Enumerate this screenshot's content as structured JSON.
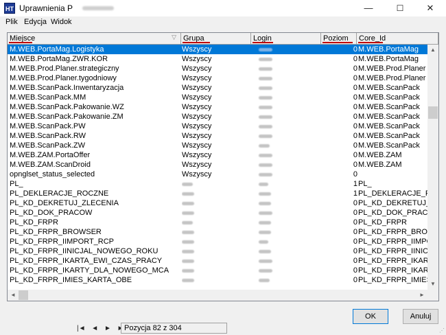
{
  "window": {
    "icon_text": "HT",
    "title": "Uprawnienia P",
    "min_glyph": "—",
    "max_glyph": "☐",
    "close_glyph": "✕"
  },
  "menu": {
    "items": [
      "Plik",
      "Edycja",
      "Widok"
    ]
  },
  "grid": {
    "columns": [
      "Miejsce",
      "Grupa",
      "Login",
      "Poziom",
      "Core_Id"
    ],
    "sort_glyph": "▽",
    "selected_index": 0,
    "rows": [
      {
        "miejsce": "M.WEB.PortaMag.Logistyka",
        "grupa": "Wszyscy",
        "poziom": "0",
        "core_id": "M.WEB.PortaMag"
      },
      {
        "miejsce": "M.WEB.PortaMag.ZWR.KOR",
        "grupa": "Wszyscy",
        "poziom": "0",
        "core_id": "M.WEB.PortaMag"
      },
      {
        "miejsce": "M.WEB.Prod.Planer.strategiczny",
        "grupa": "Wszyscy",
        "poziom": "0",
        "core_id": "M.WEB.Prod.Planer"
      },
      {
        "miejsce": "M.WEB.Prod.Planer.tygodniowy",
        "grupa": "Wszyscy",
        "poziom": "0",
        "core_id": "M.WEB.Prod.Planer"
      },
      {
        "miejsce": "M.WEB.ScanPack.Inwentaryzacja",
        "grupa": "Wszyscy",
        "poziom": "0",
        "core_id": "M.WEB.ScanPack"
      },
      {
        "miejsce": "M.WEB.ScanPack.MM",
        "grupa": "Wszyscy",
        "poziom": "0",
        "core_id": "M.WEB.ScanPack"
      },
      {
        "miejsce": "M.WEB.ScanPack.Pakowanie.WZ",
        "grupa": "Wszyscy",
        "poziom": "0",
        "core_id": "M.WEB.ScanPack"
      },
      {
        "miejsce": "M.WEB.ScanPack.Pakowanie.ZM",
        "grupa": "Wszyscy",
        "poziom": "0",
        "core_id": "M.WEB.ScanPack"
      },
      {
        "miejsce": "M.WEB.ScanPack.PW",
        "grupa": "Wszyscy",
        "poziom": "0",
        "core_id": "M.WEB.ScanPack"
      },
      {
        "miejsce": "M.WEB.ScanPack.RW",
        "grupa": "Wszyscy",
        "poziom": "0",
        "core_id": "M.WEB.ScanPack"
      },
      {
        "miejsce": "M.WEB.ScanPack.ZW",
        "grupa": "Wszyscy",
        "poziom": "0",
        "core_id": "M.WEB.ScanPack"
      },
      {
        "miejsce": "M.WEB.ZAM.PortaOffer",
        "grupa": "Wszyscy",
        "poziom": "0",
        "core_id": "M.WEB.ZAM"
      },
      {
        "miejsce": "M.WEB.ZAM.ScanDroid",
        "grupa": "Wszyscy",
        "poziom": "0",
        "core_id": "M.WEB.ZAM"
      },
      {
        "miejsce": "opnglset_status_selected",
        "grupa": "Wszyscy",
        "poziom": "0",
        "core_id": ""
      },
      {
        "miejsce": "PL_",
        "grupa": "",
        "poziom": "1",
        "core_id": "PL_"
      },
      {
        "miejsce": "PL_DEKLERACJE_ROCZNE",
        "grupa": "",
        "poziom": "1",
        "core_id": "PL_DEKLERACJE_ROCZ"
      },
      {
        "miejsce": "PL_KD_DEKRETUJ_ZLECENIA",
        "grupa": "",
        "poziom": "0",
        "core_id": "PL_KD_DEKRETUJ_ZLE("
      },
      {
        "miejsce": "PL_KD_DOK_PRACOW",
        "grupa": "",
        "poziom": "0",
        "core_id": "PL_KD_DOK_PRACOW"
      },
      {
        "miejsce": "PL_KD_FRPR",
        "grupa": "",
        "poziom": "0",
        "core_id": "PL_KD_FRPR"
      },
      {
        "miejsce": "PL_KD_FRPR_BROWSER",
        "grupa": "",
        "poziom": "0",
        "core_id": "PL_KD_FRPR_BROWSEI"
      },
      {
        "miejsce": "PL_KD_FRPR_IIMPORT_RCP",
        "grupa": "",
        "poziom": "0",
        "core_id": "PL_KD_FRPR_IIMPORT_"
      },
      {
        "miejsce": "PL_KD_FRPR_IINICJAL_NOWEGO_ROKU",
        "grupa": "",
        "poziom": "0",
        "core_id": "PL_KD_FRPR_IINICJAL_I"
      },
      {
        "miejsce": "PL_KD_FRPR_IKARTA_EWI_CZAS_PRACY",
        "grupa": "",
        "poziom": "0",
        "core_id": "PL_KD_FRPR_IKARTA_E"
      },
      {
        "miejsce": "PL_KD_FRPR_IKARTY_DLA_NOWEGO_MCA",
        "grupa": "",
        "poziom": "0",
        "core_id": "PL_KD_FRPR_IKARTY_D"
      },
      {
        "miejsce": "PL_KD_FRPR_IMIES_KARTA_OBE",
        "grupa": "",
        "poziom": "0",
        "core_id": "PL_KD_FRPR_IMIES_KA"
      }
    ]
  },
  "scroll": {
    "left": "◄",
    "right": "►",
    "up": "▲",
    "down": "▼"
  },
  "footer": {
    "nav": [
      "|◄",
      "◄",
      "►",
      "►|"
    ],
    "status": "Pozycja 82 z 304",
    "ok_label": "OK",
    "cancel_label": "Anuluj",
    "grip": "⋰"
  }
}
